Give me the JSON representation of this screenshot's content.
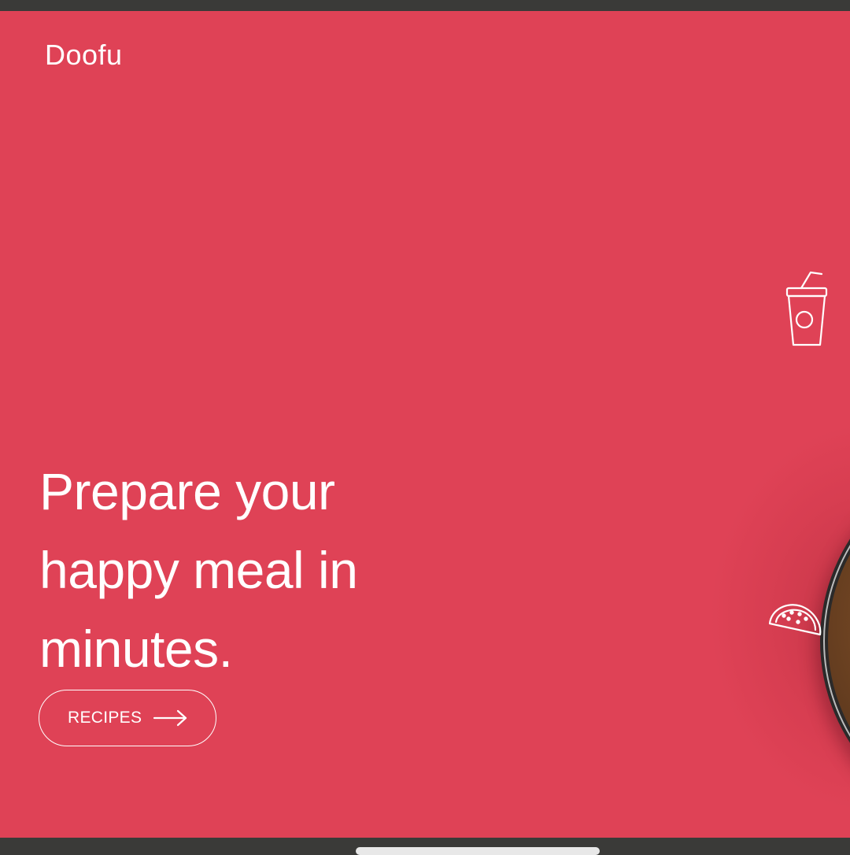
{
  "brand": {
    "name": "Doofu"
  },
  "hero": {
    "headline_lines": [
      "Prepare your",
      "happy meal in",
      "minutes."
    ],
    "cta_label": "RECIPES"
  },
  "icons": {
    "cta": "arrow-right-icon",
    "decor": [
      "drink-cup-icon",
      "taco-icon"
    ]
  },
  "colors": {
    "background": "#df4256",
    "text": "#ffffff",
    "bezel": "#3a3a38"
  }
}
